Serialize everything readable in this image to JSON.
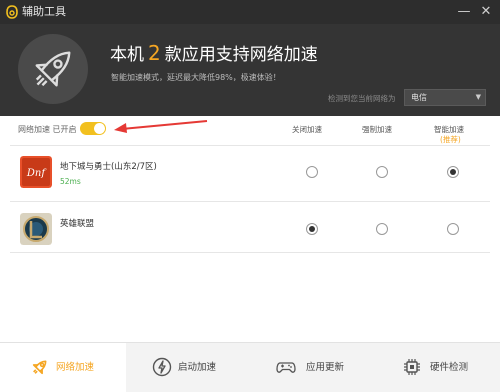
{
  "window": {
    "title": "辅助工具",
    "close_glyph": "✕",
    "min_glyph": "—"
  },
  "hero": {
    "headline_prefix": "本机",
    "headline_count": "2",
    "headline_suffix": "款应用支持网络加速",
    "subtitle": "智能加速模式，延迟最大降低98%，极速体验！",
    "network_label": "检测到您当前网络为",
    "network_value": "电信",
    "icon": "rocket-icon"
  },
  "accel": {
    "toggle_label": "网络加速 已开启",
    "toggle_on": true,
    "accent": "#f2c01f"
  },
  "columns": {
    "off": "关闭加速",
    "force": "强制加速",
    "smart": "智能加速",
    "recommended": "(推荐)"
  },
  "games": [
    {
      "name": "地下城与勇士(山东2/7区)",
      "ping": "52ms",
      "icon": "dnf-logo",
      "selected": "smart"
    },
    {
      "name": "英雄联盟",
      "ping": "",
      "icon": "lol-logo",
      "selected": "off"
    }
  ],
  "nav": {
    "tabs": [
      {
        "label": "网络加速",
        "icon": "rocket-icon",
        "active": true
      },
      {
        "label": "启动加速",
        "icon": "lightning-icon",
        "active": false
      },
      {
        "label": "应用更新",
        "icon": "gamepad-icon",
        "active": false
      },
      {
        "label": "硬件检测",
        "icon": "chip-icon",
        "active": false
      }
    ]
  },
  "colors": {
    "accent": "#f5a623",
    "hero_bg": "#343434",
    "green": "#4caf50"
  }
}
